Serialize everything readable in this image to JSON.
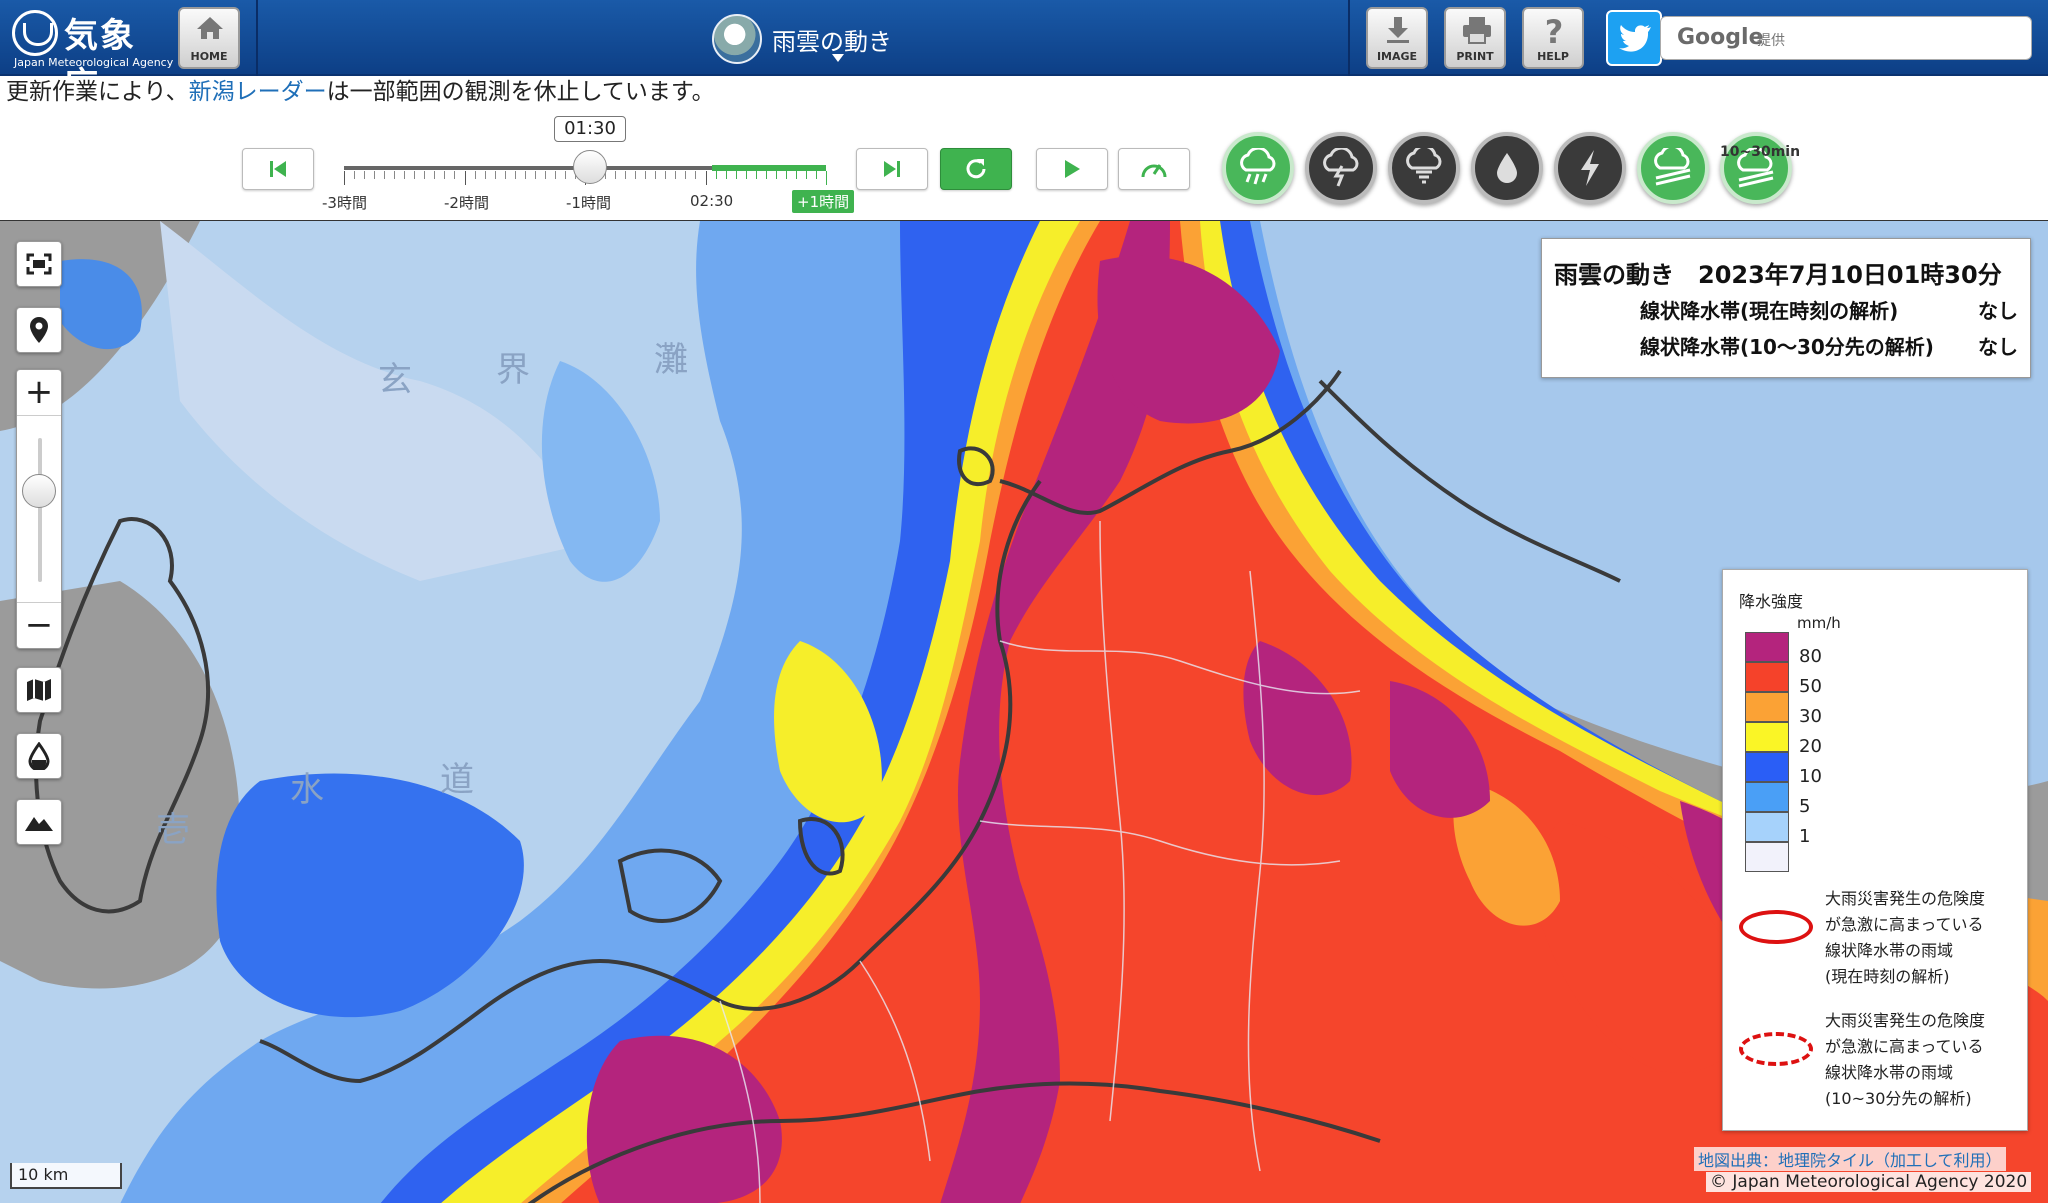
{
  "header": {
    "logo_ja": "気象庁",
    "logo_en": "Japan Meteorological Agency",
    "home_label": "HOME",
    "title": "雨雲の動き",
    "image_label": "IMAGE",
    "print_label": "PRINT",
    "help_label": "HELP",
    "search_brand": "Google",
    "search_provided": "提供"
  },
  "notice": {
    "before": "更新作業により、",
    "link": "新潟レーダー",
    "after": "は一部範囲の観測を休止しています。"
  },
  "timeline": {
    "current": "01:30",
    "labels": [
      "-3時間",
      "-2時間",
      "-1時間",
      "02:30",
      "+1時間"
    ]
  },
  "infobox": {
    "title": "雨雲の動き　2023年7月10日01時30分",
    "row1_label": "線状降水帯(現在時刻の解析)",
    "row1_value": "なし",
    "row2_label": "線状降水帯(10～30分先の解析)",
    "row2_value": "なし"
  },
  "layers": {
    "badge": "10~30min"
  },
  "legend": {
    "title": "降水強度",
    "unit": "mm/h",
    "levels": [
      {
        "label": "80",
        "color": "#b4247d"
      },
      {
        "label": "50",
        "color": "#f5422a"
      },
      {
        "label": "30",
        "color": "#fba235"
      },
      {
        "label": "20",
        "color": "#faf526"
      },
      {
        "label": "10",
        "color": "#2a5ef6"
      },
      {
        "label": "5",
        "color": "#4a9ff6"
      },
      {
        "label": "1",
        "color": "#a6d2fb"
      },
      {
        "label": "",
        "color": "#f2f2fb"
      }
    ],
    "note1": [
      "大雨災害発生の危険度",
      "が急激に高まっている",
      "線状降水帯の雨域",
      "(現在時刻の解析)"
    ],
    "note2": [
      "大雨災害発生の危険度",
      "が急激に高まっている",
      "線状降水帯の雨域",
      "(10~30分先の解析)"
    ]
  },
  "map": {
    "credit": "地図出典：地理院タイル（加工して利用）",
    "copyright": "© Japan Meteorological Agency 2020",
    "scale": "10 km",
    "sea_labels": [
      "玄",
      "界",
      "灘",
      "水",
      "道",
      "壱"
    ]
  }
}
